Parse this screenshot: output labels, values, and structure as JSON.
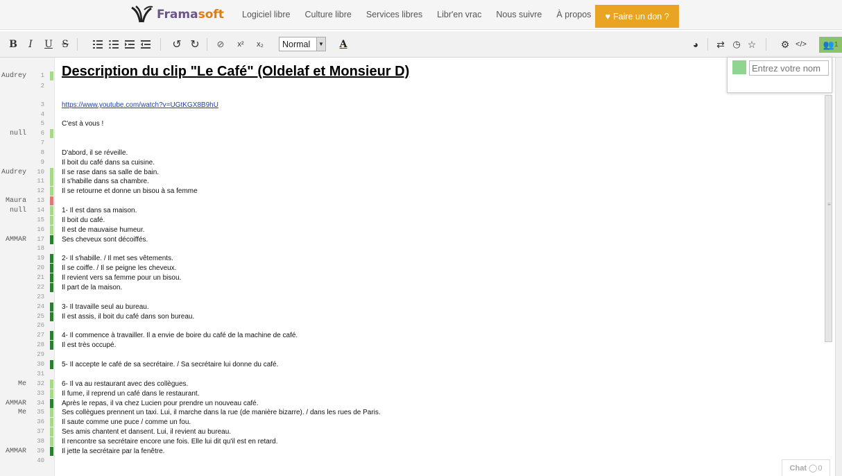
{
  "nav": {
    "logo_main": "Frama",
    "logo_accent": "soft",
    "links": [
      "Logiciel libre",
      "Culture libre",
      "Services libres",
      "Libr'en vrac",
      "Nous suivre",
      "À propos"
    ],
    "donate": "Faire un don ?"
  },
  "toolbar": {
    "bold": "B",
    "italic": "I",
    "underline": "U",
    "strike": "S",
    "superscript": "x²",
    "subscript": "x₂",
    "style_select": "Normal",
    "text_color": "A",
    "user_count": "1"
  },
  "user_panel": {
    "name_placeholder": "Entrez votre nom",
    "user_color": "#8fd48f"
  },
  "document": {
    "title": "Description du clip \"Le Café\" (Oldelaf et Monsieur D)",
    "lines": [
      {
        "n": "1",
        "author": "Audrey",
        "text": "",
        "color": "#a8d98a"
      },
      {
        "n": "2",
        "author": "",
        "text": "",
        "color": ""
      },
      {
        "n": "3",
        "author": "",
        "text": "https://www.youtube.com/watch?v=UGtKGX8B9hU",
        "color": ""
      },
      {
        "n": "4",
        "author": "",
        "text": "",
        "color": ""
      },
      {
        "n": "5",
        "author": "",
        "text": "C'est à vous !",
        "color": ""
      },
      {
        "n": "6",
        "author": "null",
        "text": "",
        "color": "#a8d98a"
      },
      {
        "n": "7",
        "author": "",
        "text": "",
        "color": ""
      },
      {
        "n": "8",
        "author": "",
        "text": "D'abord, il se réveille.",
        "color": ""
      },
      {
        "n": "9",
        "author": "",
        "text": "Il boit du café dans sa cuisine.",
        "color": ""
      },
      {
        "n": "10",
        "author": "Audrey",
        "text": "Il se rase dans sa salle de bain.",
        "color": "#a8d98a"
      },
      {
        "n": "11",
        "author": "",
        "text": "Il s'habille dans sa chambre.",
        "color": "#a8d98a"
      },
      {
        "n": "12",
        "author": "",
        "text": "Il se retourne et donne un bisou à sa femme",
        "color": "#a8d98a"
      },
      {
        "n": "13",
        "author": "Maura",
        "text": "",
        "color": "#e07a7a"
      },
      {
        "n": "14",
        "author": "null",
        "text": "1- Il est dans sa maison.",
        "color": "#a8d98a"
      },
      {
        "n": "15",
        "author": "",
        "text": "Il boit du café.",
        "color": "#a8d98a"
      },
      {
        "n": "16",
        "author": "",
        "text": "Il est de mauvaise humeur.",
        "color": "#a8d98a"
      },
      {
        "n": "17",
        "author": "AMMAR",
        "text": "Ses cheveux sont décoiffés.",
        "color": "#2e7d32"
      },
      {
        "n": "18",
        "author": "",
        "text": "",
        "color": ""
      },
      {
        "n": "19",
        "author": "",
        "text": "2- Il s'habille. / Il met ses vêtements.",
        "color": "#2e7d32"
      },
      {
        "n": "20",
        "author": "",
        "text": "Il se coiffe. / Il se peigne les cheveux.",
        "color": "#2e7d32"
      },
      {
        "n": "21",
        "author": "",
        "text": "Il revient vers sa femme pour un bisou.",
        "color": "#2e7d32"
      },
      {
        "n": "22",
        "author": "",
        "text": "Il part de la maison.",
        "color": "#2e7d32"
      },
      {
        "n": "23",
        "author": "",
        "text": "",
        "color": ""
      },
      {
        "n": "24",
        "author": "",
        "text": "3- Il travaille seul au bureau.",
        "color": "#2e7d32"
      },
      {
        "n": "25",
        "author": "",
        "text": "Il est assis, il boit du café dans son bureau.",
        "color": "#2e7d32"
      },
      {
        "n": "26",
        "author": "",
        "text": "",
        "color": ""
      },
      {
        "n": "27",
        "author": "",
        "text": "4- Il commence à travailler. Il a envie de boire du café de la machine de café.",
        "color": "#2e7d32"
      },
      {
        "n": "28",
        "author": "",
        "text": "Il est très occupé.",
        "color": "#2e7d32"
      },
      {
        "n": "29",
        "author": "",
        "text": "",
        "color": ""
      },
      {
        "n": "30",
        "author": "",
        "text": "5- Il accepte le café de sa secrétaire. / Sa secrétaire lui donne du café.",
        "color": "#2e7d32"
      },
      {
        "n": "31",
        "author": "",
        "text": "",
        "color": ""
      },
      {
        "n": "32",
        "author": "Me",
        "text": "6- Il va au restaurant avec des collègues.",
        "color": "#a8d98a"
      },
      {
        "n": "33",
        "author": "",
        "text": "Il fume, il reprend un café dans le restaurant.",
        "color": "#a8d98a"
      },
      {
        "n": "34",
        "author": "AMMAR",
        "text": "Après le repas, il va chez Lucien pour prendre un nouveau café.",
        "color": "#2e7d32"
      },
      {
        "n": "35",
        "author": "Me",
        "text": "Ses collègues prennent un taxi. Lui, il marche dans la rue (de manière bizarre). / dans les rues de Paris.",
        "color": "#a8d98a"
      },
      {
        "n": "36",
        "author": "",
        "text": "Il saute comme une puce / comme un fou.",
        "color": "#a8d98a"
      },
      {
        "n": "37",
        "author": "",
        "text": "Ses amis chantent et dansent. Lui, il revient au bureau.",
        "color": "#a8d98a"
      },
      {
        "n": "38",
        "author": "",
        "text": "Il rencontre sa secrétaire encore une fois. Elle lui dit qu'il est en retard.",
        "color": "#a8d98a"
      },
      {
        "n": "39",
        "author": "AMMAR",
        "text": "Il jette la secrétaire par la fenêtre.",
        "color": "#2e7d32"
      },
      {
        "n": "40",
        "author": "",
        "text": "",
        "color": ""
      }
    ]
  },
  "chat": {
    "label": "Chat",
    "count": "0"
  }
}
